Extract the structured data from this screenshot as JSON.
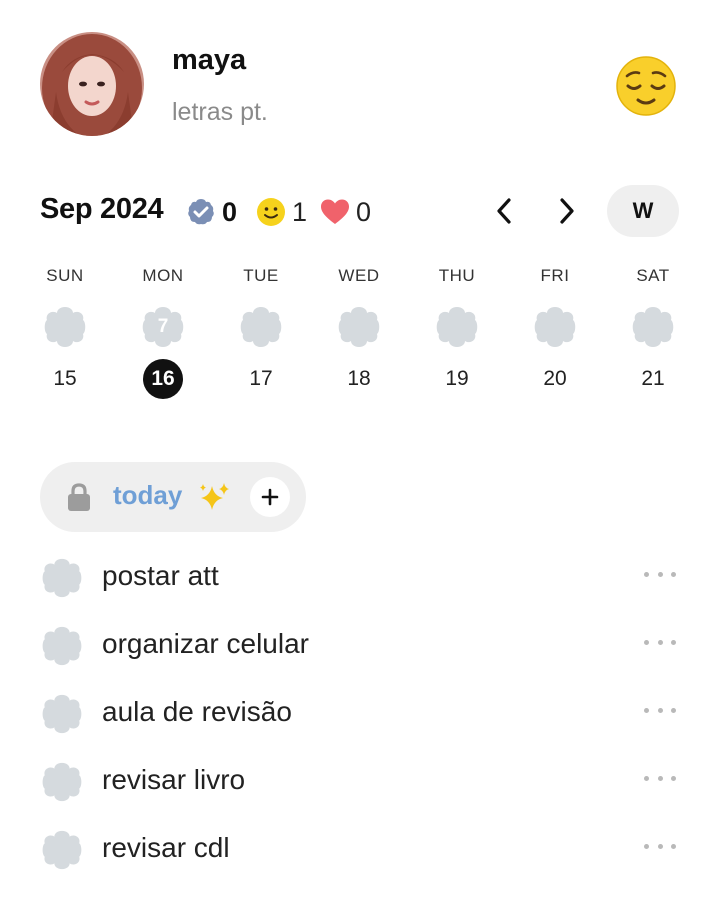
{
  "profile": {
    "name": "maya",
    "subtitle": "letras pt.",
    "mood_icon": "relieved-face-emoji"
  },
  "calendar": {
    "month_label": "Sep 2024",
    "stats": [
      {
        "icon": "completed-badge-icon",
        "value": "0"
      },
      {
        "icon": "smiley-icon",
        "value": "1"
      },
      {
        "icon": "heart-icon",
        "value": "0"
      }
    ],
    "prev_icon": "chevron-left-icon",
    "next_icon": "chevron-right-icon",
    "view_toggle_label": "W",
    "days": [
      {
        "name": "SUN",
        "date": "15",
        "blob_count": "",
        "today": false
      },
      {
        "name": "MON",
        "date": "16",
        "blob_count": "7",
        "today": true
      },
      {
        "name": "TUE",
        "date": "17",
        "blob_count": "",
        "today": false
      },
      {
        "name": "WED",
        "date": "18",
        "blob_count": "",
        "today": false
      },
      {
        "name": "THU",
        "date": "19",
        "blob_count": "",
        "today": false
      },
      {
        "name": "FRI",
        "date": "20",
        "blob_count": "",
        "today": false
      },
      {
        "name": "SAT",
        "date": "21",
        "blob_count": "",
        "today": false
      }
    ]
  },
  "goal": {
    "label": "today",
    "lock_icon": "lock-icon",
    "emoji_icon": "sparkles-icon",
    "add_icon": "plus-icon"
  },
  "tasks": [
    {
      "text": "postar att"
    },
    {
      "text": "organizar celular"
    },
    {
      "text": "aula de revisão"
    },
    {
      "text": "revisar livro"
    },
    {
      "text": "revisar cdl"
    }
  ],
  "colors": {
    "blob": "#d5dade",
    "accent_blue": "#6f9fd6",
    "badge_blue": "#7b8fb5",
    "heart_red": "#f0626b",
    "smiley_yellow": "#f6d21c"
  }
}
